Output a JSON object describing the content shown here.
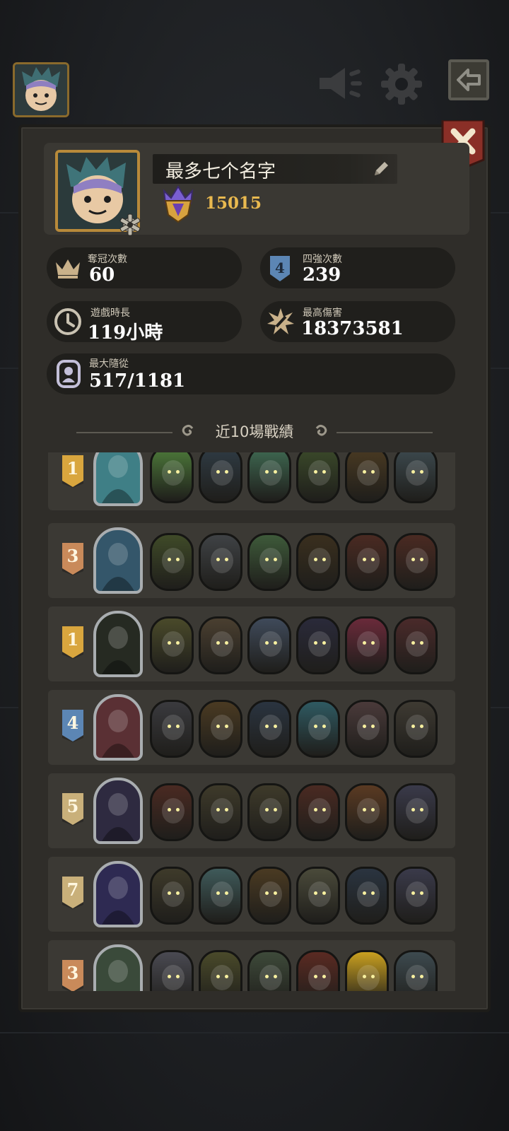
{
  "profile": {
    "name": "最多七个名字",
    "trophies": "15015"
  },
  "stats": {
    "championships": {
      "label": "奪冠次數",
      "value": "60",
      "icon": "crown-icon"
    },
    "top4": {
      "label": "四強次數",
      "value": "239",
      "icon": "top4-shield-icon",
      "badge": "4"
    },
    "playtime": {
      "label": "遊戲時長",
      "value": "119小時",
      "icon": "clock-icon"
    },
    "max_damage": {
      "label": "最高傷害",
      "value": "18373581",
      "icon": "damage-burst-icon"
    },
    "max_followers": {
      "label": "最大隨從",
      "value": "517/1181",
      "icon": "follower-icon"
    }
  },
  "history": {
    "title": "近10場戰績",
    "matches": [
      {
        "place": "1",
        "badge_color": "#d9a63e",
        "hero_color": "#3f7f86",
        "units": [
          "#4d7a3a",
          "#2f3b44",
          "#3f6a52",
          "#3b4a2a",
          "#4a3a22",
          "#3d4a4f"
        ]
      },
      {
        "place": "3",
        "badge_color": "#c98a5a",
        "hero_color": "#34566a",
        "units": [
          "#3f4a28",
          "#3f4245",
          "#3e5a3a",
          "#3a2f1e",
          "#4a2a22",
          "#4a2a22"
        ]
      },
      {
        "place": "1",
        "badge_color": "#d9a63e",
        "hero_color": "#262a22",
        "units": [
          "#4a4a2a",
          "#4a3f30",
          "#3f4a5a",
          "#2a2a3a",
          "#6a2a3a",
          "#4a2a2a"
        ]
      },
      {
        "place": "4",
        "badge_color": "#5c86b4",
        "hero_color": "#5a3034",
        "units": [
          "#3a3a3e",
          "#4a3a22",
          "#2a3440",
          "#2f5a62",
          "#4a3a3a",
          "#3e3a32"
        ]
      },
      {
        "place": "5",
        "badge_color": "#c9b07a",
        "hero_color": "#2e2a40",
        "units": [
          "#4a2a22",
          "#3e3a2a",
          "#3e3a2a",
          "#4a2a22",
          "#5a3a22",
          "#3a3a4a"
        ]
      },
      {
        "place": "7",
        "badge_color": "#c9b07a",
        "hero_color": "#2e2a52",
        "units": [
          "#3e3a2a",
          "#3f5a5a",
          "#4a3a22",
          "#4a4a3a",
          "#2a3440",
          "#3a3a4a"
        ]
      },
      {
        "place": "3",
        "badge_color": "#c98a5a",
        "hero_color": "#3a4a3a",
        "units": [
          "#4a4a52",
          "#4a4a2a",
          "#3e4a3a",
          "#5a2a22",
          "#c9a020",
          "#3d4a4f"
        ]
      }
    ]
  }
}
